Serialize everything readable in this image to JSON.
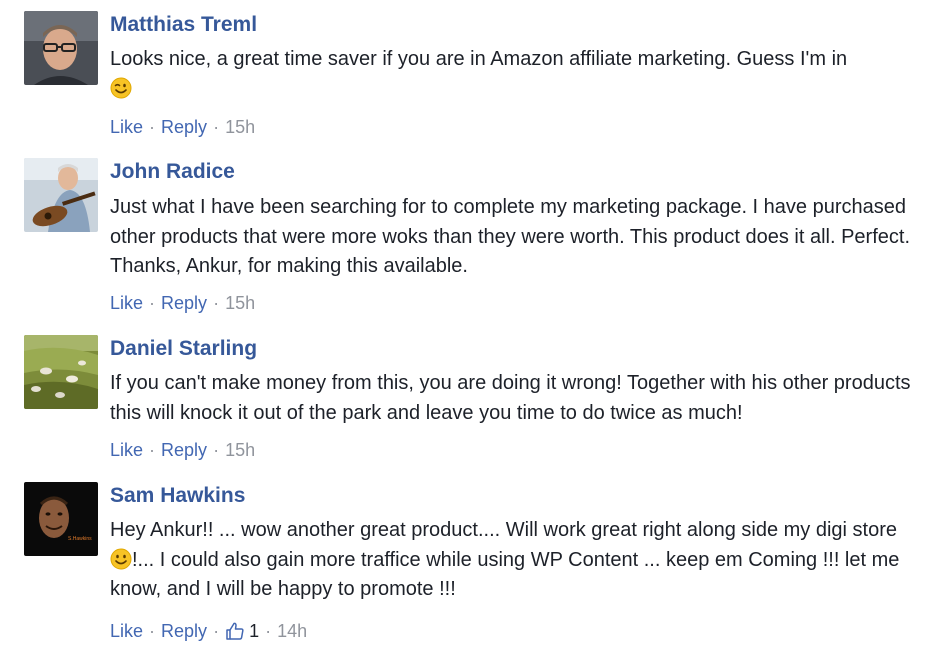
{
  "comments": [
    {
      "author": "Matthias Treml",
      "text_before": "Looks nice, a great time saver if you are in Amazon affiliate marketing. Guess I'm in",
      "emoji": "wink-emoji",
      "like": "Like",
      "reply": "Reply",
      "time": "15h"
    },
    {
      "author": "John Radice",
      "text": "Just what I have been searching for to complete my marketing package. I have purchased other products that were more woks than they were worth. This product does it all. Perfect. Thanks, Ankur, for making this available.",
      "like": "Like",
      "reply": "Reply",
      "time": "15h"
    },
    {
      "author": "Daniel Starling",
      "text": "If you can't make money from this, you are doing it wrong! Together with his other products this will knock it out of the park and leave you time to do twice as much!",
      "like": "Like",
      "reply": "Reply",
      "time": "15h"
    },
    {
      "author": "Sam Hawkins",
      "text_before": "Hey Ankur!! ... wow another great product.... Will work great right along side my digi store ",
      "emoji": "smile-emoji",
      "text_after": "!... I could also gain more traffice while using WP Content ... keep em Coming !!! let me know, and I will be happy to promote !!!",
      "like": "Like",
      "reply": "Reply",
      "like_count": "1",
      "time": "14h",
      "avatar_caption": "S.Hawkins"
    }
  ],
  "colors": {
    "author": "#365899",
    "link": "#4267b2",
    "meta": "#90949c",
    "text": "#1d2129"
  }
}
